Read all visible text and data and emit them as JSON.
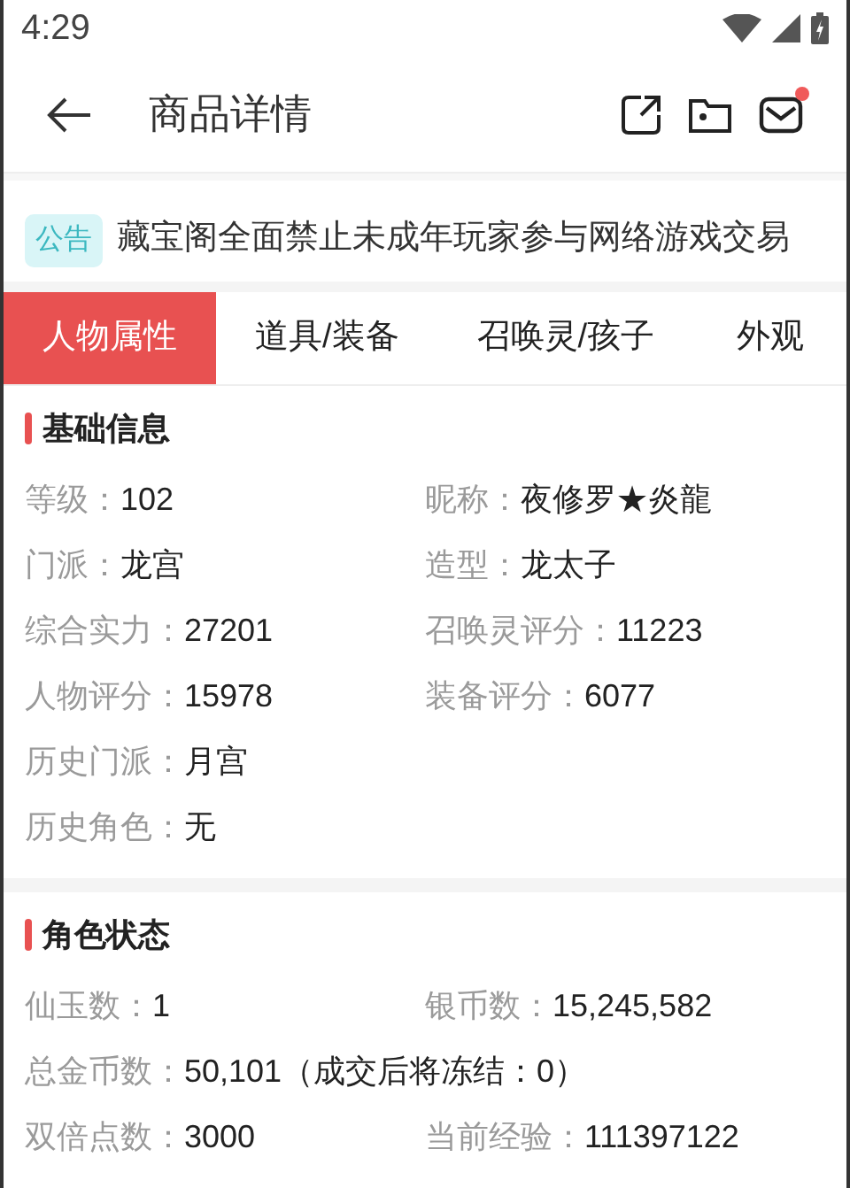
{
  "status_bar": {
    "time": "4:29"
  },
  "header": {
    "title": "商品详情",
    "mail_unread": true
  },
  "notice": {
    "badge": "公告",
    "text": "藏宝阁全面禁止未成年玩家参与网络游戏交易"
  },
  "tabs": [
    {
      "label": "人物属性",
      "selected": true
    },
    {
      "label": "道具/装备",
      "selected": false
    },
    {
      "label": "召唤灵/孩子",
      "selected": false
    },
    {
      "label": "外观",
      "selected": false
    }
  ],
  "sections": [
    {
      "title": "基础信息",
      "fields": [
        {
          "label": "等级：",
          "value": "102",
          "kind": "half"
        },
        {
          "label": "昵称：",
          "value": "夜修罗★炎龍",
          "kind": "half"
        },
        {
          "label": "门派：",
          "value": "龙宫",
          "kind": "half"
        },
        {
          "label": "造型：",
          "value": "龙太子",
          "kind": "half"
        },
        {
          "label": "综合实力：",
          "value": "27201",
          "kind": "half"
        },
        {
          "label": "召唤灵评分：",
          "value": "11223",
          "kind": "half"
        },
        {
          "label": "人物评分：",
          "value": "15978",
          "kind": "half"
        },
        {
          "label": "装备评分：",
          "value": "6077",
          "kind": "half"
        },
        {
          "label": "历史门派：",
          "value": "月宫",
          "kind": "full"
        },
        {
          "label": "历史角色：",
          "value": "无",
          "kind": "full"
        }
      ]
    },
    {
      "title": "角色状态",
      "fields": [
        {
          "label": "仙玉数：",
          "value": "1",
          "kind": "half"
        },
        {
          "label": "银币数：",
          "value": "15,245,582",
          "kind": "half"
        },
        {
          "label": "总金币数：",
          "value": "50,101（成交后将冻结：0）",
          "kind": "full"
        },
        {
          "label": "双倍点数：",
          "value": "3000",
          "kind": "half"
        },
        {
          "label": "当前经验：",
          "value": "111397122",
          "kind": "half"
        }
      ]
    }
  ]
}
